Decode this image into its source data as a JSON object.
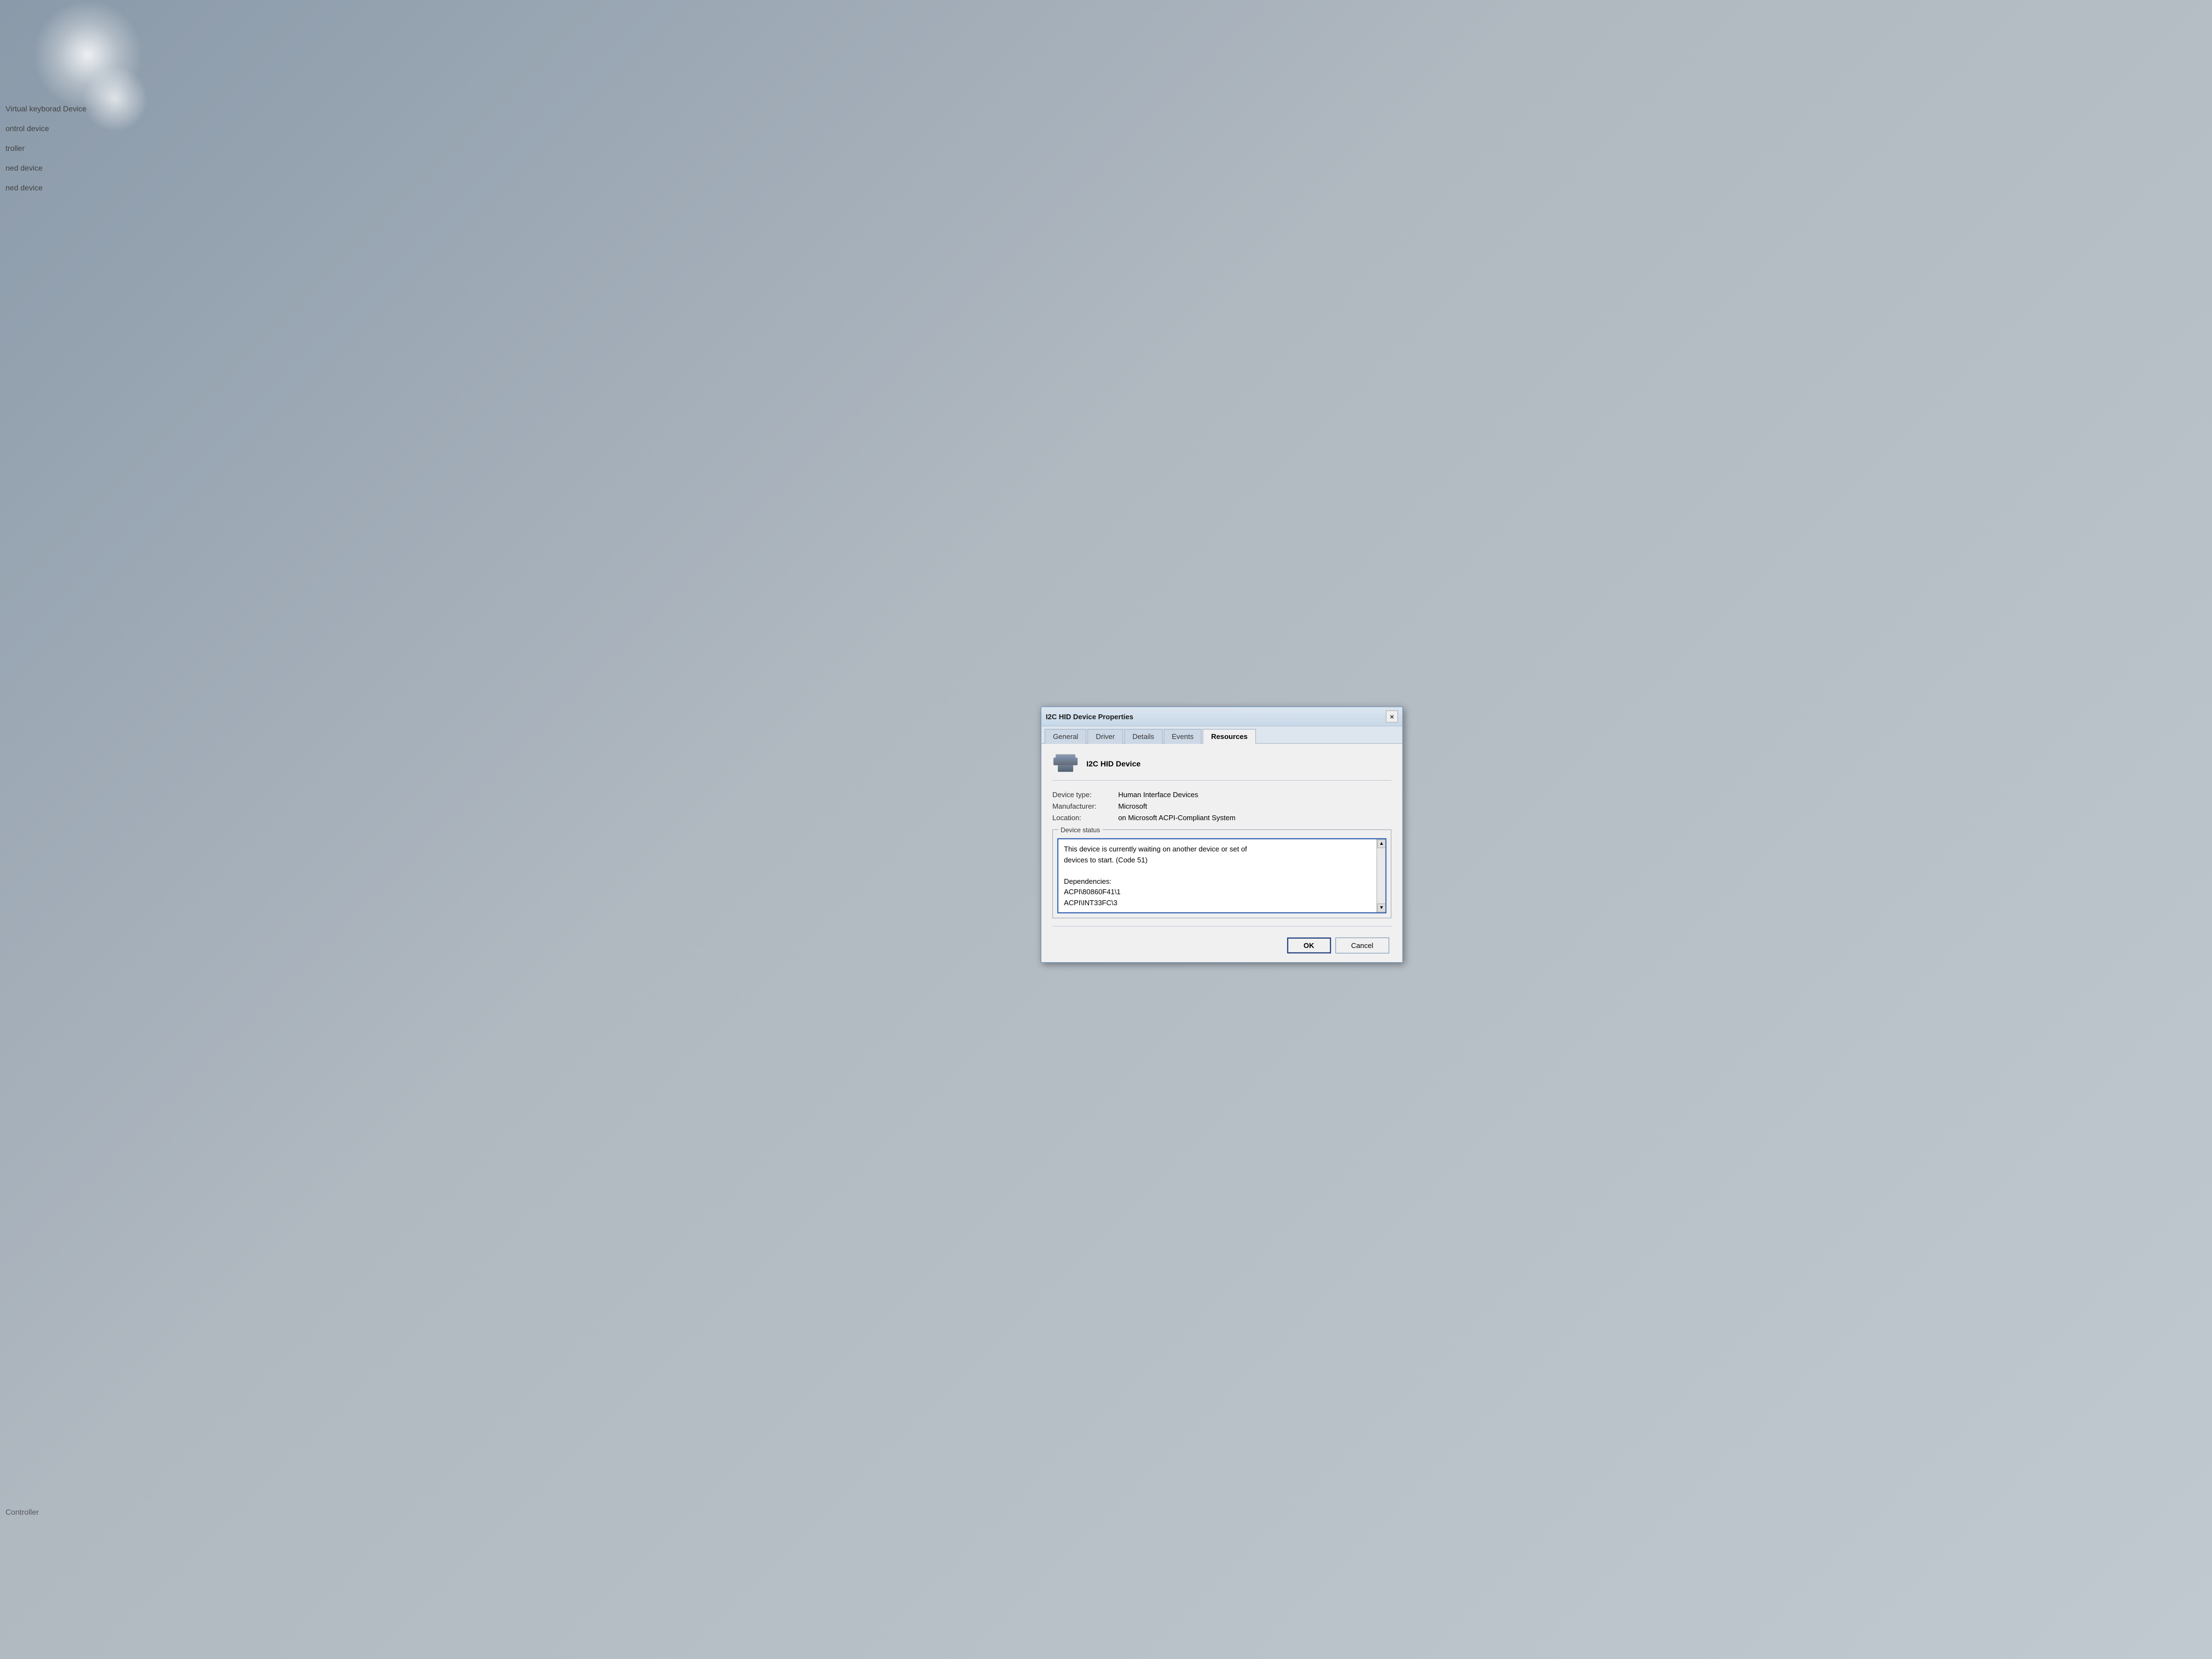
{
  "background": {
    "list_items": [
      "Virtual keyborad Device",
      "ontrol device",
      "troller",
      "ned device",
      "ned device"
    ],
    "bottom_item": "Controller"
  },
  "dialog": {
    "title": "I2C HID Device Properties",
    "close_button_label": "×",
    "tabs": [
      {
        "id": "general",
        "label": "General",
        "active": false
      },
      {
        "id": "driver",
        "label": "Driver",
        "active": false
      },
      {
        "id": "details",
        "label": "Details",
        "active": false
      },
      {
        "id": "events",
        "label": "Events",
        "active": false
      },
      {
        "id": "resources",
        "label": "Resources",
        "active": true
      }
    ],
    "device_name": "I2C HID Device",
    "properties": {
      "device_type_label": "Device type:",
      "device_type_value": "Human Interface Devices",
      "manufacturer_label": "Manufacturer:",
      "manufacturer_value": "Microsoft",
      "location_label": "Location:",
      "location_value": "on Microsoft ACPI-Compliant System"
    },
    "status_section": {
      "legend": "Device status",
      "status_text": "This device is currently waiting on another device or set of devices to start. (Code 51)\n\nDependencies:\nACPI\\80860F41\\1\nACPI\\INT33FC\\3"
    },
    "buttons": {
      "ok_label": "OK",
      "cancel_label": "Cancel"
    }
  }
}
